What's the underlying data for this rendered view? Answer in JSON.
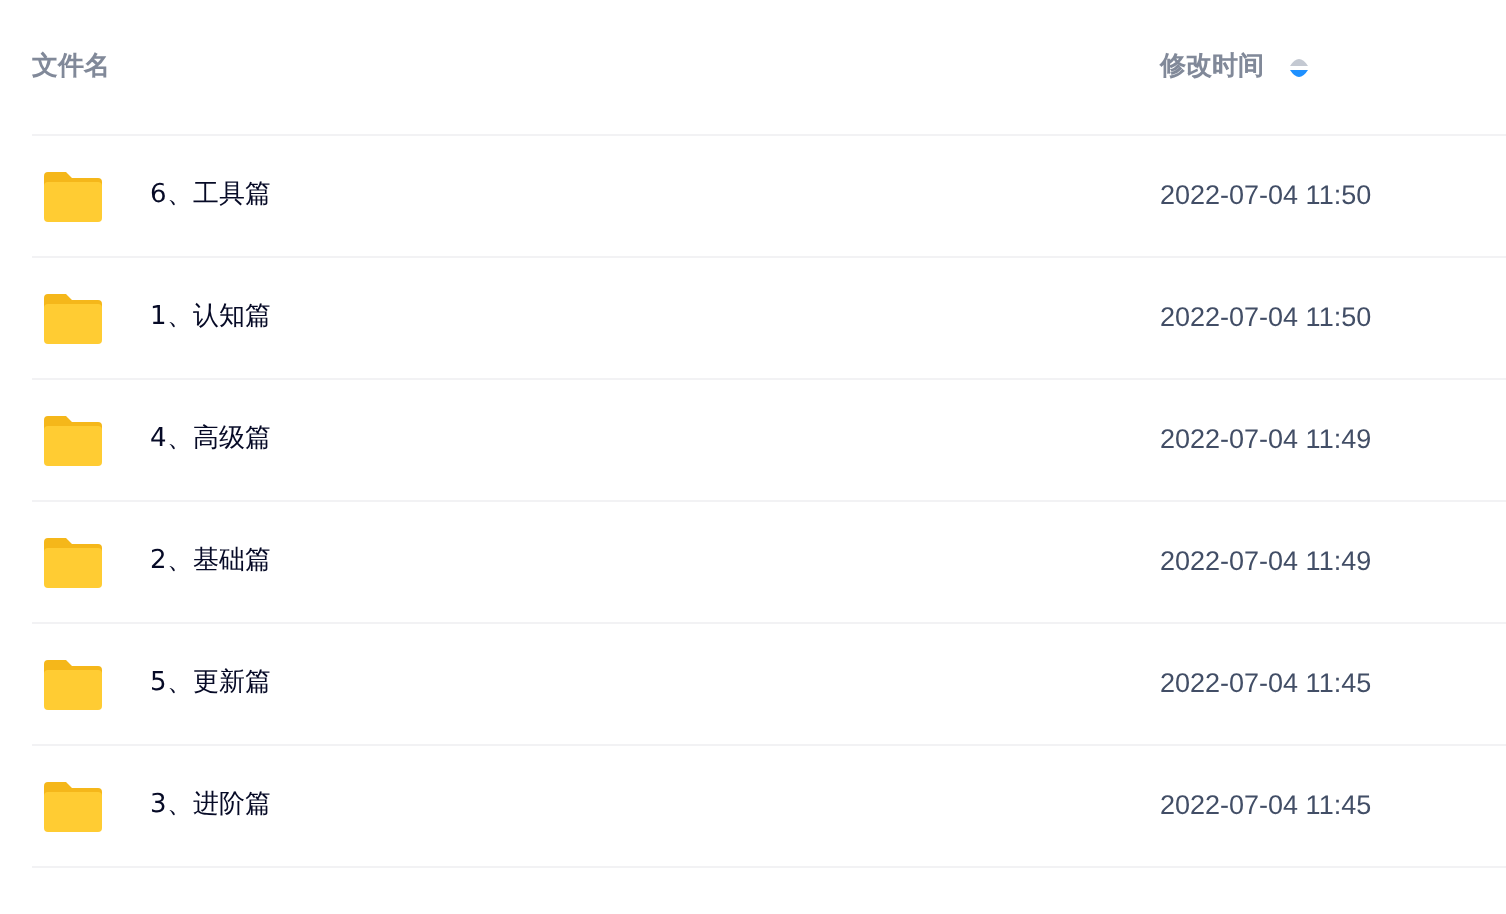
{
  "columns": [
    {
      "label": "文件名"
    },
    {
      "label": "修改时间",
      "sorted": true,
      "descending": true
    }
  ],
  "rows": [
    {
      "name": "6、工具篇",
      "modified": "2022-07-04 11:50"
    },
    {
      "name": "1、认知篇",
      "modified": "2022-07-04 11:50"
    },
    {
      "name": "4、高级篇",
      "modified": "2022-07-04 11:49"
    },
    {
      "name": "2、基础篇",
      "modified": "2022-07-04 11:49"
    },
    {
      "name": "5、更新篇",
      "modified": "2022-07-04 11:45"
    },
    {
      "name": "3、进阶篇",
      "modified": "2022-07-04 11:45"
    }
  ]
}
